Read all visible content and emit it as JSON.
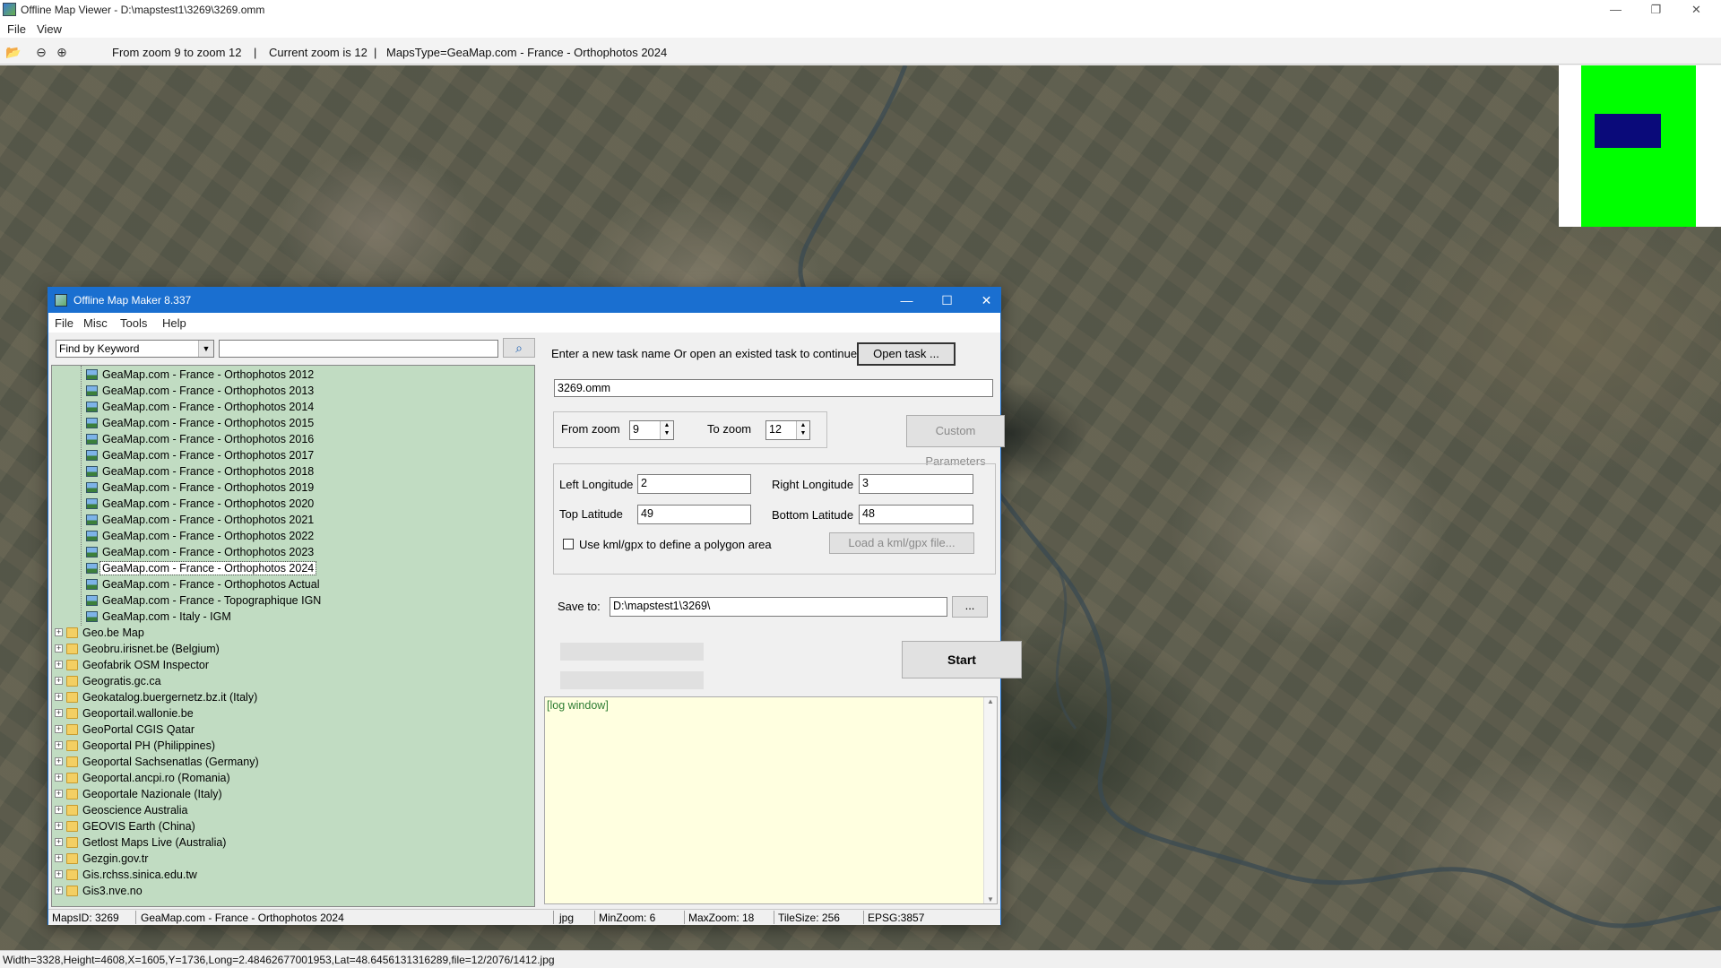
{
  "outer_window": {
    "title": "Offline Map Viewer - D:\\mapstest1\\3269\\3269.omm",
    "controls": {
      "minimize": "—",
      "maximize": "❐",
      "close": "✕"
    },
    "menu": [
      "File",
      "View"
    ]
  },
  "toolbar": {
    "zoom_range": "From zoom 9 to zoom 12",
    "current_zoom": "Current zoom is 12",
    "maps_type": "MapsType=GeaMap.com - France - Orthophotos 2024",
    "sep1": "|",
    "sep2": "|",
    "icons": {
      "open": "📂",
      "zoom_out": "⊖",
      "zoom_in": "⊕"
    }
  },
  "minimap": {
    "frame_color": "#00ff00",
    "viewport_color": "#0a0a7a"
  },
  "statusbar": {
    "text": "Width=3328,Height=4608,X=1605,Y=1736,Long=2.48462677001953,Lat=48.6456131316289,file=12/2076/1412.jpg"
  },
  "dialog": {
    "title": "Offline Map Maker 8.337",
    "controls": {
      "minimize": "—",
      "maximize": "☐",
      "close": "✕"
    },
    "menu": [
      "File",
      "Misc",
      "Tools",
      "Help"
    ],
    "search": {
      "mode": "Find by Keyword",
      "keyword": "",
      "button_icon": "⌕"
    },
    "tree": {
      "children": [
        "GeaMap.com - France - Orthophotos 2012",
        "GeaMap.com - France - Orthophotos 2013",
        "GeaMap.com - France - Orthophotos 2014",
        "GeaMap.com - France - Orthophotos 2015",
        "GeaMap.com - France - Orthophotos 2016",
        "GeaMap.com - France - Orthophotos 2017",
        "GeaMap.com - France - Orthophotos 2018",
        "GeaMap.com - France - Orthophotos 2019",
        "GeaMap.com - France - Orthophotos 2020",
        "GeaMap.com - France - Orthophotos 2021",
        "GeaMap.com - France - Orthophotos 2022",
        "GeaMap.com - France - Orthophotos 2023",
        "GeaMap.com - France - Orthophotos 2024",
        "GeaMap.com - France - Orthophotos Actual",
        "GeaMap.com - France - Topographique IGN",
        "GeaMap.com - Italy - IGM"
      ],
      "selected": "GeaMap.com - France - Orthophotos 2024",
      "folders": [
        "Geo.be Map",
        "Geobru.irisnet.be (Belgium)",
        "Geofabrik OSM Inspector",
        "Geogratis.gc.ca",
        "Geokatalog.buergernetz.bz.it (Italy)",
        "Geoportail.wallonie.be",
        "GeoPortal CGIS Qatar",
        "Geoportal PH (Philippines)",
        "Geoportal Sachsenatlas (Germany)",
        "Geoportal.ancpi.ro (Romania)",
        "Geoportale Nazionale (Italy)",
        "Geoscience Australia",
        "GEOVIS Earth (China)",
        "Getlost Maps Live (Australia)",
        "Gezgin.gov.tr",
        "Gis.rchss.sinica.edu.tw",
        "Gis3.nve.no"
      ],
      "expand_glyph": "+"
    },
    "task": {
      "prompt": "Enter a new task name Or open an existed task to continue:",
      "open_button": "Open task ...",
      "name": "3269.omm"
    },
    "zoom": {
      "from_label": "From zoom",
      "from_value": "9",
      "to_label": "To zoom",
      "to_value": "12",
      "custom_button": "Custom Parameters",
      "spin_up": "▲",
      "spin_down": "▼"
    },
    "bounds": {
      "left_label": "Left Longitude",
      "left_value": "2",
      "right_label": "Right Longitude",
      "right_value": "3",
      "top_label": "Top Latitude",
      "top_value": "49",
      "bottom_label": "Bottom Latitude",
      "bottom_value": "48",
      "kml_label": "Use kml/gpx to define a polygon area",
      "kml_checked": false,
      "kml_button": "Load a kml/gpx file..."
    },
    "save": {
      "label": "Save to:",
      "path": "D:\\mapstest1\\3269\\",
      "browse": "..."
    },
    "start_button": "Start",
    "log": {
      "text": "[log window]",
      "scroll_up": "▲",
      "scroll_down": "▼"
    },
    "status": {
      "maps_id": "MapsID: 3269",
      "name": "GeaMap.com - France - Orthophotos 2024",
      "format": "jpg",
      "min_zoom": "MinZoom: 6",
      "max_zoom": "MaxZoom: 18",
      "tile_size": "TileSize: 256",
      "epsg": "EPSG:3857"
    }
  }
}
